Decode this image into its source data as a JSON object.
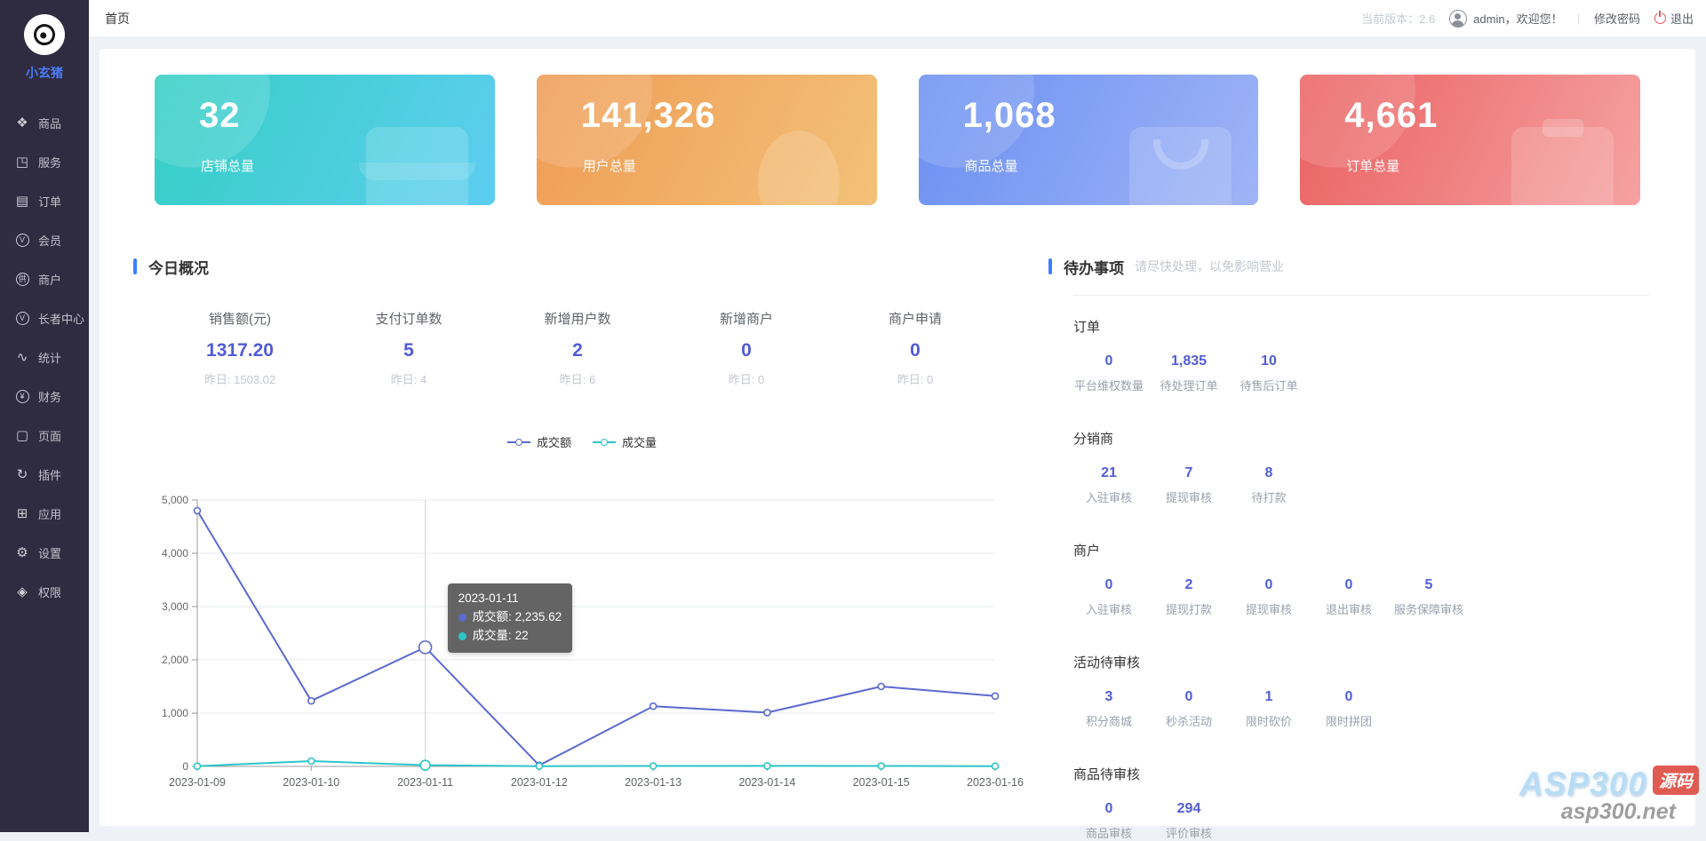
{
  "brand": {
    "name": "小玄猪"
  },
  "sidebar": {
    "items": [
      {
        "icon": "goods-icon",
        "label": "商品"
      },
      {
        "icon": "services-icon",
        "label": "服务"
      },
      {
        "icon": "orders-icon",
        "label": "订单"
      },
      {
        "icon": "members-icon",
        "label": "会员"
      },
      {
        "icon": "merchants-icon",
        "label": "商户"
      },
      {
        "icon": "elder-center-icon",
        "label": "长者中心"
      },
      {
        "icon": "statistics-icon",
        "label": "统计"
      },
      {
        "icon": "finance-icon",
        "label": "财务"
      },
      {
        "icon": "pages-icon",
        "label": "页面"
      },
      {
        "icon": "plugins-icon",
        "label": "插件"
      },
      {
        "icon": "apps-icon",
        "label": "应用"
      },
      {
        "icon": "settings-icon",
        "label": "设置"
      },
      {
        "icon": "permissions-icon",
        "label": "权限"
      }
    ]
  },
  "header": {
    "tab": "首页",
    "version_label": "当前版本：",
    "version": "2.6",
    "welcome": "admin，欢迎您！",
    "separator": "|",
    "change_password": "修改密码",
    "logout": "退出"
  },
  "stat_cards": [
    {
      "value": "32",
      "label": "店铺总量",
      "icon": "shop-icon",
      "gradient_from": "#34cfc4",
      "gradient_to": "#5ecdf0"
    },
    {
      "value": "141,326",
      "label": "用户总量",
      "icon": "user-icon",
      "gradient_from": "#ef9c55",
      "gradient_to": "#f3c178"
    },
    {
      "value": "1,068",
      "label": "商品总量",
      "icon": "bag-icon",
      "gradient_from": "#6b90f2",
      "gradient_to": "#9fb4f6"
    },
    {
      "value": "4,661",
      "label": "订单总量",
      "icon": "clipboard-icon",
      "gradient_from": "#eb6161",
      "gradient_to": "#f5a2a2"
    }
  ],
  "today": {
    "title": "今日概况",
    "stats": [
      {
        "label": "销售额(元)",
        "value": "1317.20",
        "yesterday": "昨日: 1503.02"
      },
      {
        "label": "支付订单数",
        "value": "5",
        "yesterday": "昨日: 4"
      },
      {
        "label": "新增用户数",
        "value": "2",
        "yesterday": "昨日: 6"
      },
      {
        "label": "新增商户",
        "value": "0",
        "yesterday": "昨日: 0"
      },
      {
        "label": "商户申请",
        "value": "0",
        "yesterday": "昨日: 0"
      }
    ]
  },
  "chart_data": {
    "type": "line",
    "x": [
      "2023-01-09",
      "2023-01-10",
      "2023-01-11",
      "2023-01-12",
      "2023-01-13",
      "2023-01-14",
      "2023-01-15",
      "2023-01-16"
    ],
    "series": [
      {
        "name": "成交额",
        "color": "#5a6acf",
        "values": [
          4800,
          1230,
          2235.62,
          20,
          1130,
          1010,
          1500,
          1320
        ]
      },
      {
        "name": "成交量",
        "color": "#2dc5c8",
        "values": [
          5,
          100,
          22,
          5,
          8,
          10,
          8,
          5
        ]
      }
    ],
    "ylim": [
      0,
      5000
    ],
    "yticks": [
      0,
      1000,
      2000,
      3000,
      4000,
      5000
    ],
    "grid": true,
    "legend_position": "top-center",
    "tooltip": {
      "date": "2023-01-11",
      "highlight_index": 2,
      "rows": [
        {
          "label": "成交额",
          "value": "2,235.62",
          "color": "#5a6acf"
        },
        {
          "label": "成交量",
          "value": "22",
          "color": "#2dc5c8"
        }
      ]
    }
  },
  "todo": {
    "title": "待办事项",
    "subtitle": "请尽快处理，以免影响营业",
    "groups": [
      {
        "title": "订单",
        "items": [
          {
            "value": "0",
            "label": "平台维权数量"
          },
          {
            "value": "1,835",
            "label": "待处理订单"
          },
          {
            "value": "10",
            "label": "待售后订单"
          }
        ]
      },
      {
        "title": "分销商",
        "items": [
          {
            "value": "21",
            "label": "入驻审核"
          },
          {
            "value": "7",
            "label": "提现审核"
          },
          {
            "value": "8",
            "label": "待打款"
          }
        ]
      },
      {
        "title": "商户",
        "items": [
          {
            "value": "0",
            "label": "入驻审核"
          },
          {
            "value": "2",
            "label": "提现打款"
          },
          {
            "value": "0",
            "label": "提现审核"
          },
          {
            "value": "0",
            "label": "退出审核"
          },
          {
            "value": "5",
            "label": "服务保障审核"
          }
        ]
      },
      {
        "title": "活动待审核",
        "items": [
          {
            "value": "3",
            "label": "积分商城"
          },
          {
            "value": "0",
            "label": "秒杀活动"
          },
          {
            "value": "1",
            "label": "限时砍价"
          },
          {
            "value": "0",
            "label": "限时拼团"
          }
        ]
      },
      {
        "title": "商品待审核",
        "items": [
          {
            "value": "0",
            "label": "商品审核"
          },
          {
            "value": "294",
            "label": "评价审核"
          }
        ]
      }
    ]
  },
  "watermark": {
    "title": "ASP300",
    "badge": "源码",
    "site": "asp300.net"
  },
  "colors": {
    "accent_blue": "#3d7eff",
    "stat_value": "#525cd6",
    "sidebar_bg": "#2f2b40",
    "logout_red": "#e25555"
  }
}
